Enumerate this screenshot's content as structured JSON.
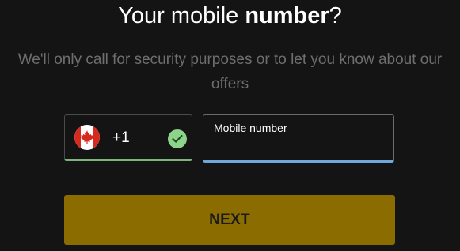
{
  "heading": {
    "prefix": "Your mobile ",
    "emphasis": "number",
    "suffix": "?"
  },
  "subtitle": "We'll only call for security purposes or to let you know about our offers",
  "country_selector": {
    "flag_icon": "canada-flag-icon",
    "dial_code": "+1",
    "status_icon": "checkmark-circle-icon",
    "status_color": "#8ed38b"
  },
  "mobile_field": {
    "label": "Mobile number",
    "value": "",
    "underline_color": "#6fa8d8"
  },
  "next_button": {
    "label": "NEXT",
    "background": "#8a6c00"
  }
}
